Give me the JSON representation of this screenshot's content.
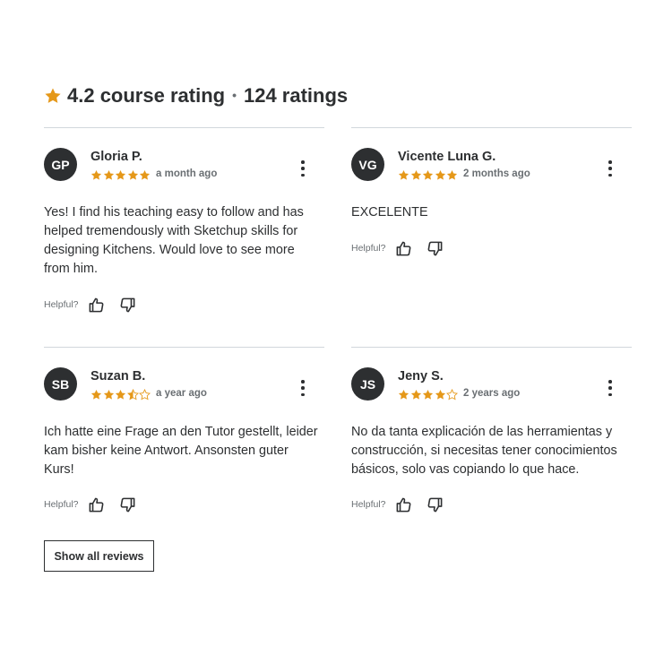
{
  "header": {
    "rating": "4.2 course rating",
    "separator": "•",
    "count": "124 ratings",
    "star_icon": "star-icon",
    "star_color": "#e59819"
  },
  "reviews": [
    {
      "initials": "GP",
      "name": "Gloria P.",
      "stars": 5,
      "date": "a month ago",
      "text": "Yes! I find his teaching easy to follow and has helped tremendously with Sketchup skills for designing Kitchens. Would love to see more from him.",
      "helpful": "Helpful?"
    },
    {
      "initials": "VG",
      "name": "Vicente Luna G.",
      "stars": 5,
      "date": "2 months ago",
      "text": "EXCELENTE",
      "helpful": "Helpful?"
    },
    {
      "initials": "SB",
      "name": "Suzan B.",
      "stars": 3.5,
      "date": "a year ago",
      "text": "Ich hatte eine Frage an den Tutor gestellt, leider kam bisher keine Antwort. Ansonsten guter Kurs!",
      "helpful": "Helpful?"
    },
    {
      "initials": "JS",
      "name": "Jeny S.",
      "stars": 4,
      "date": "2 years ago",
      "text": "No da tanta explicación de las herramientas y construcción, si necesitas tener conocimientos básicos, solo vas copiando lo que hace.",
      "helpful": "Helpful?"
    }
  ],
  "show_all_label": "Show all reviews",
  "colors": {
    "text": "#2d2f31",
    "muted": "#6a6f73",
    "star": "#e59819",
    "divider": "#d1d7dc",
    "avatar_bg": "#2d2f31"
  }
}
